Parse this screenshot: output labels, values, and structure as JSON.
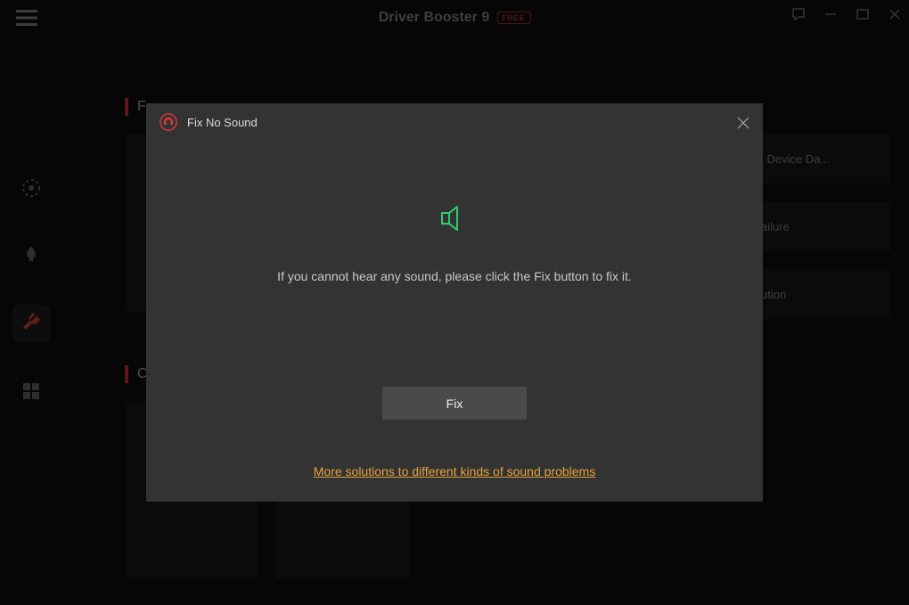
{
  "titlebar": {
    "app_title": "Driver Booster 9",
    "badge": "FREE"
  },
  "sections": {
    "top_label_prefix": "F",
    "bottom_label_prefix": "C"
  },
  "right_cards": [
    "l Device Da...",
    "ailure",
    "ution"
  ],
  "modal": {
    "title": "Fix No Sound",
    "message": "If you cannot hear any sound, please click the Fix button to fix it.",
    "fix_label": "Fix",
    "more_link": "More solutions to different kinds of sound problems"
  }
}
